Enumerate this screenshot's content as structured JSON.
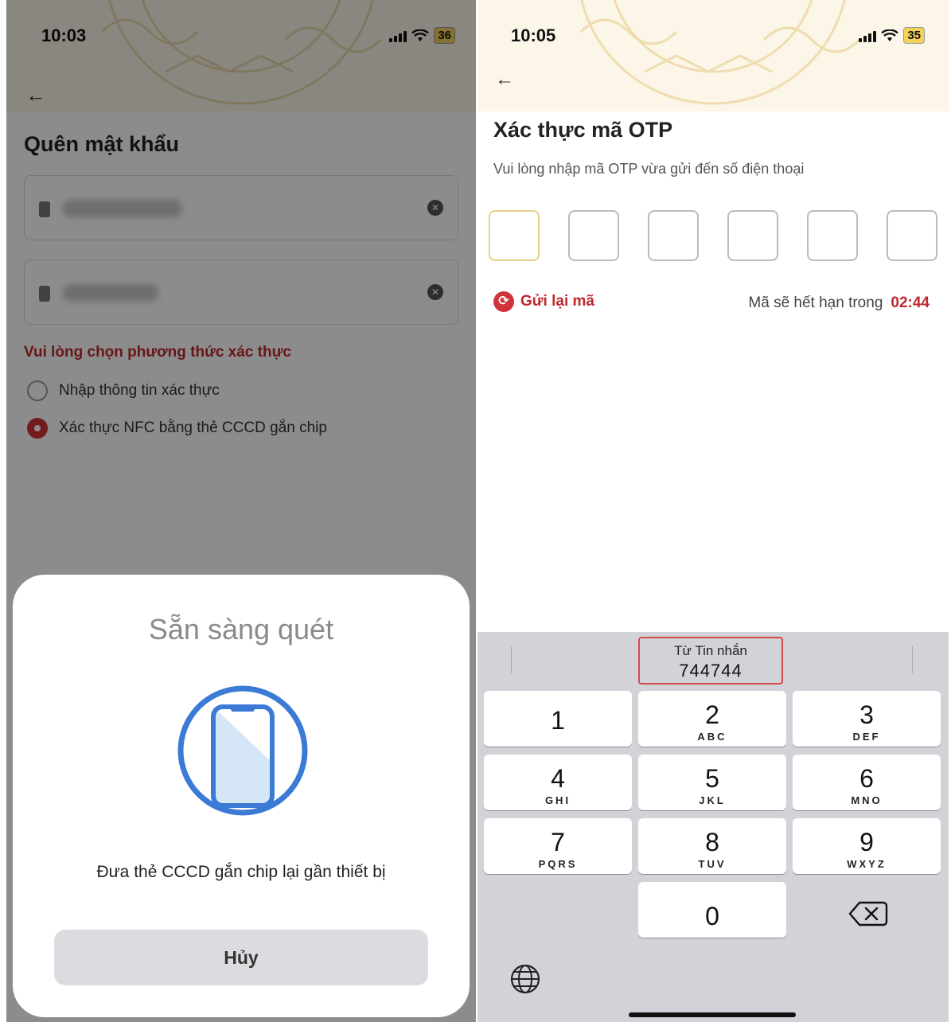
{
  "left": {
    "status": {
      "time": "10:03",
      "battery": "36"
    },
    "title": "Quên mật khẩu",
    "auth_prompt": "Vui lòng chọn phương thức xác thực",
    "options": [
      {
        "label": "Nhập thông tin xác thực",
        "selected": false
      },
      {
        "label": "Xác thực NFC bằng thẻ CCCD gắn chip",
        "selected": true
      }
    ],
    "sheet": {
      "title": "Sẵn sàng quét",
      "message": "Đưa thẻ CCCD gắn chip lại gần thiết bị",
      "cancel_label": "Hủy"
    }
  },
  "right": {
    "status": {
      "time": "10:05",
      "battery": "35"
    },
    "title": "Xác thực mã OTP",
    "subtitle": "Vui lòng nhập mã OTP vừa gửi đến số điện thoại",
    "otp_length": 6,
    "resend_label": "Gửi lại mã",
    "expire_label": "Mã sẽ hết hạn trong",
    "countdown": "02:44",
    "keyboard": {
      "suggestion_label": "Từ Tin nhắn",
      "suggestion_code": "744744",
      "keys": [
        {
          "num": "1",
          "letters": ""
        },
        {
          "num": "2",
          "letters": "ABC"
        },
        {
          "num": "3",
          "letters": "DEF"
        },
        {
          "num": "4",
          "letters": "GHI"
        },
        {
          "num": "5",
          "letters": "JKL"
        },
        {
          "num": "6",
          "letters": "MNO"
        },
        {
          "num": "7",
          "letters": "PQRS"
        },
        {
          "num": "8",
          "letters": "TUV"
        },
        {
          "num": "9",
          "letters": "WXYZ"
        },
        {
          "num": "0",
          "letters": ""
        }
      ]
    }
  },
  "colors": {
    "accent_red": "#c0282d",
    "otp_active_border": "#e8cf8a",
    "nfc_blue": "#3b7bd6"
  }
}
